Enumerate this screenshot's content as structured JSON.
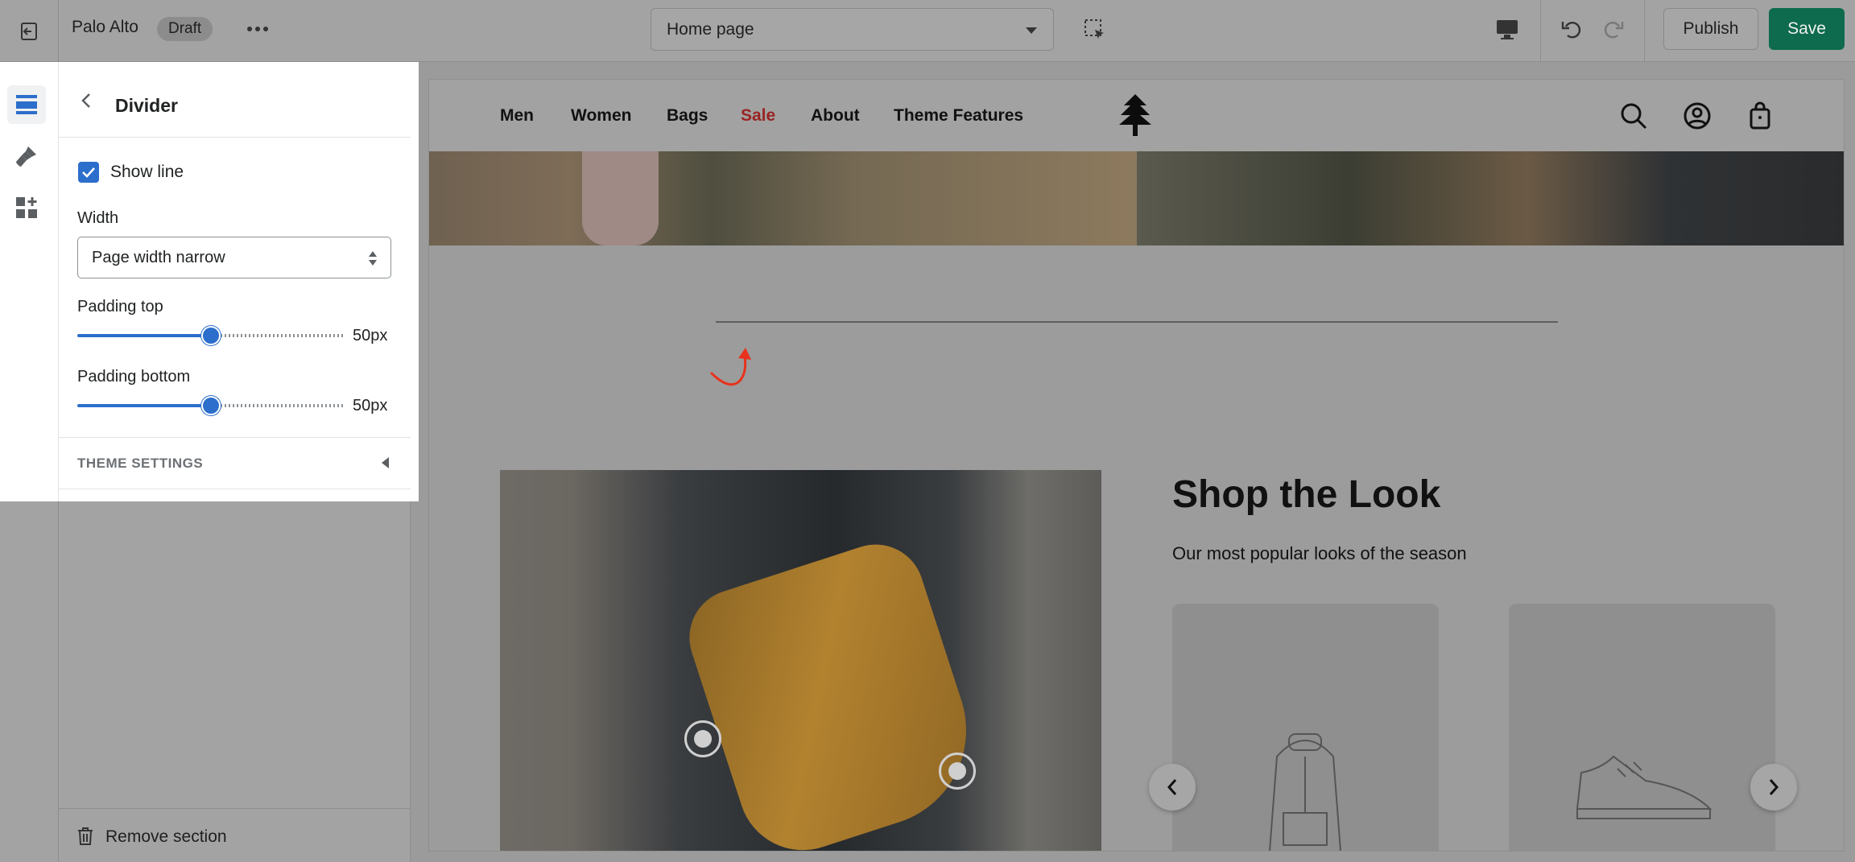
{
  "topbar": {
    "store_name": "Palo Alto",
    "status_badge": "Draft",
    "page_select": "Home page",
    "publish_label": "Publish",
    "save_label": "Save",
    "save_color": "#0e6b4d"
  },
  "panel": {
    "title": "Divider",
    "show_line_label": "Show line",
    "show_line_checked": true,
    "width_label": "Width",
    "width_value": "Page width narrow",
    "padding_top_label": "Padding top",
    "padding_top_value": "50px",
    "padding_top_fraction": 0.5,
    "padding_bottom_label": "Padding bottom",
    "padding_bottom_value": "50px",
    "padding_bottom_fraction": 0.5,
    "theme_settings_label": "THEME SETTINGS",
    "accent_color": "#2c6ecb"
  },
  "sidebar": {
    "remove_section_label": "Remove section"
  },
  "preview": {
    "nav": [
      {
        "label": "Men"
      },
      {
        "label": "Women"
      },
      {
        "label": "Bags"
      },
      {
        "label": "Sale",
        "color": "#9a2424"
      },
      {
        "label": "About"
      },
      {
        "label": "Theme Features"
      }
    ],
    "look_title": "Shop the Look",
    "look_subtitle": "Our most popular looks of the season"
  },
  "icons": {
    "rail": [
      "sections-icon",
      "theme-brush-icon",
      "apps-icon"
    ],
    "topbar": [
      "exit-icon",
      "more-icon",
      "inspector-icon",
      "desktop-icon",
      "undo-icon",
      "redo-icon"
    ],
    "store": [
      "search-icon",
      "account-icon",
      "cart-icon"
    ]
  }
}
